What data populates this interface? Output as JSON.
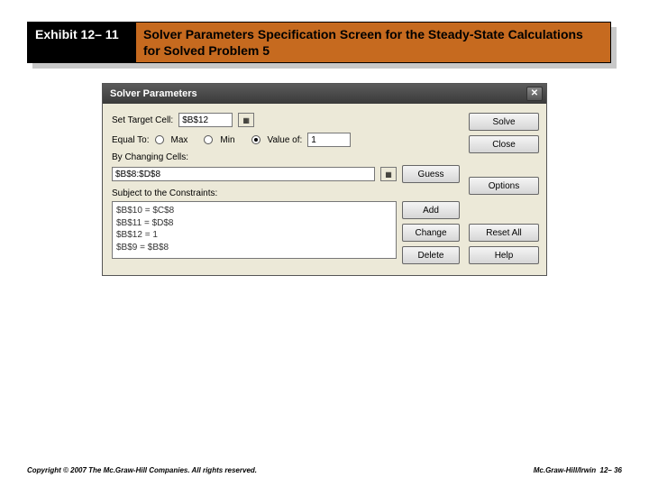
{
  "header": {
    "exhibit": "Exhibit 12– 11",
    "title": "Solver Parameters Specification Screen for the Steady-State Calculations for Solved Problem 5"
  },
  "dialog": {
    "title": "Solver Parameters",
    "labels": {
      "set_target": "Set Target Cell:",
      "equal_to": "Equal To:",
      "max": "Max",
      "min": "Min",
      "value_of": "Value of:",
      "by_changing": "By Changing Cells:",
      "subject": "Subject to the Constraints:"
    },
    "fields": {
      "target_cell": "$B$12",
      "value_of": "1",
      "changing_cells": "$B$8:$D$8"
    },
    "constraints": [
      "$B$10 = $C$8",
      "$B$11 = $D$8",
      "$B$12 = 1",
      "$B$9 = $B$8"
    ],
    "buttons": {
      "solve": "Solve",
      "close": "Close",
      "guess": "Guess",
      "options": "Options",
      "add": "Add",
      "change": "Change",
      "delete": "Delete",
      "reset": "Reset All",
      "help": "Help"
    }
  },
  "footer": {
    "left": "Copyright © 2007 The Mc.Graw-Hill Companies. All rights reserved.",
    "right_brand": "Mc.Graw-Hill/Irwin",
    "right_page": "12– 36"
  }
}
